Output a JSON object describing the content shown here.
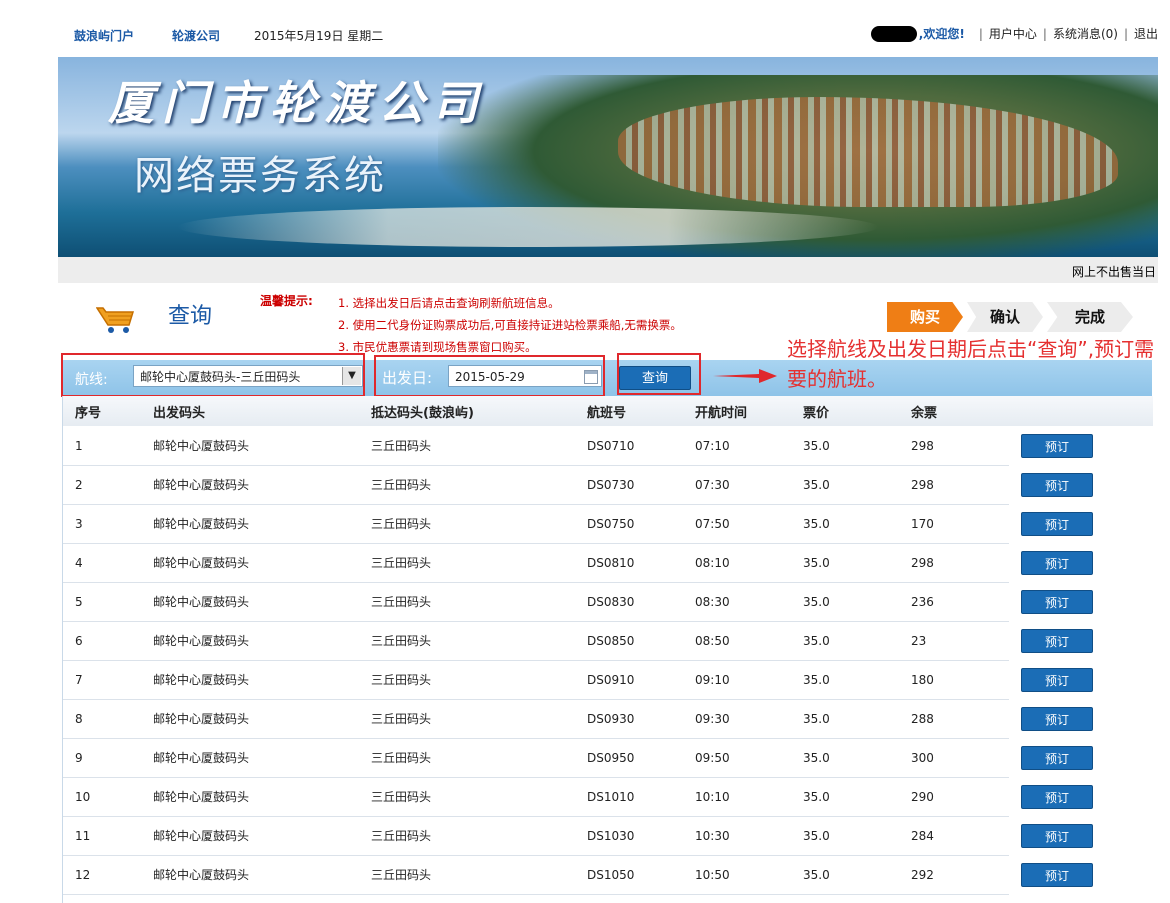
{
  "topbar": {
    "portal_link": "鼓浪屿门户",
    "company_link": "轮渡公司",
    "date_text": "2015年5月19日  星期二",
    "welcome": ",欢迎您!",
    "user_center": "用户中心",
    "messages": "系统消息(0)",
    "logout": "退出"
  },
  "banner": {
    "title": "厦门市轮渡公司",
    "subtitle": "网络票务系统",
    "notice": "网上不出售当日"
  },
  "query": {
    "title": "查询",
    "tips_label": "温馨提示:",
    "tips": [
      "1. 选择出发日后请点击查询刷新航班信息。",
      "2. 使用二代身份证购票成功后,可直接持证进站检票乘船,无需换票。",
      "3. 市民优惠票请到现场售票窗口购买。"
    ]
  },
  "steps": [
    "购买",
    "确认",
    "完成"
  ],
  "search": {
    "route_label": "航线:",
    "route_value": "邮轮中心厦鼓码头-三丘田码头",
    "date_label": "出发日:",
    "date_value": "2015-05-29",
    "button": "查询"
  },
  "annotation": "选择航线及出发日期后点击“查询”,预订需要的航班。",
  "table": {
    "headers": [
      "序号",
      "出发码头",
      "抵达码头(鼓浪屿)",
      "航班号",
      "开航时间",
      "票价",
      "余票"
    ],
    "book_label": "预订",
    "rows": [
      [
        "1",
        "邮轮中心厦鼓码头",
        "三丘田码头",
        "DS0710",
        "07:10",
        "35.0",
        "298"
      ],
      [
        "2",
        "邮轮中心厦鼓码头",
        "三丘田码头",
        "DS0730",
        "07:30",
        "35.0",
        "298"
      ],
      [
        "3",
        "邮轮中心厦鼓码头",
        "三丘田码头",
        "DS0750",
        "07:50",
        "35.0",
        "170"
      ],
      [
        "4",
        "邮轮中心厦鼓码头",
        "三丘田码头",
        "DS0810",
        "08:10",
        "35.0",
        "298"
      ],
      [
        "5",
        "邮轮中心厦鼓码头",
        "三丘田码头",
        "DS0830",
        "08:30",
        "35.0",
        "236"
      ],
      [
        "6",
        "邮轮中心厦鼓码头",
        "三丘田码头",
        "DS0850",
        "08:50",
        "35.0",
        "23"
      ],
      [
        "7",
        "邮轮中心厦鼓码头",
        "三丘田码头",
        "DS0910",
        "09:10",
        "35.0",
        "180"
      ],
      [
        "8",
        "邮轮中心厦鼓码头",
        "三丘田码头",
        "DS0930",
        "09:30",
        "35.0",
        "288"
      ],
      [
        "9",
        "邮轮中心厦鼓码头",
        "三丘田码头",
        "DS0950",
        "09:50",
        "35.0",
        "300"
      ],
      [
        "10",
        "邮轮中心厦鼓码头",
        "三丘田码头",
        "DS1010",
        "10:10",
        "35.0",
        "290"
      ],
      [
        "11",
        "邮轮中心厦鼓码头",
        "三丘田码头",
        "DS1030",
        "10:30",
        "35.0",
        "284"
      ],
      [
        "12",
        "邮轮中心厦鼓码头",
        "三丘田码头",
        "DS1050",
        "10:50",
        "35.0",
        "292"
      ]
    ]
  },
  "colors": {
    "accent": "#1c5aa6",
    "button": "#1b6db6",
    "step_active": "#ef7e15",
    "tips": "#cc0000",
    "annotation": "#e53030",
    "searchbar": "#9fcdee"
  }
}
